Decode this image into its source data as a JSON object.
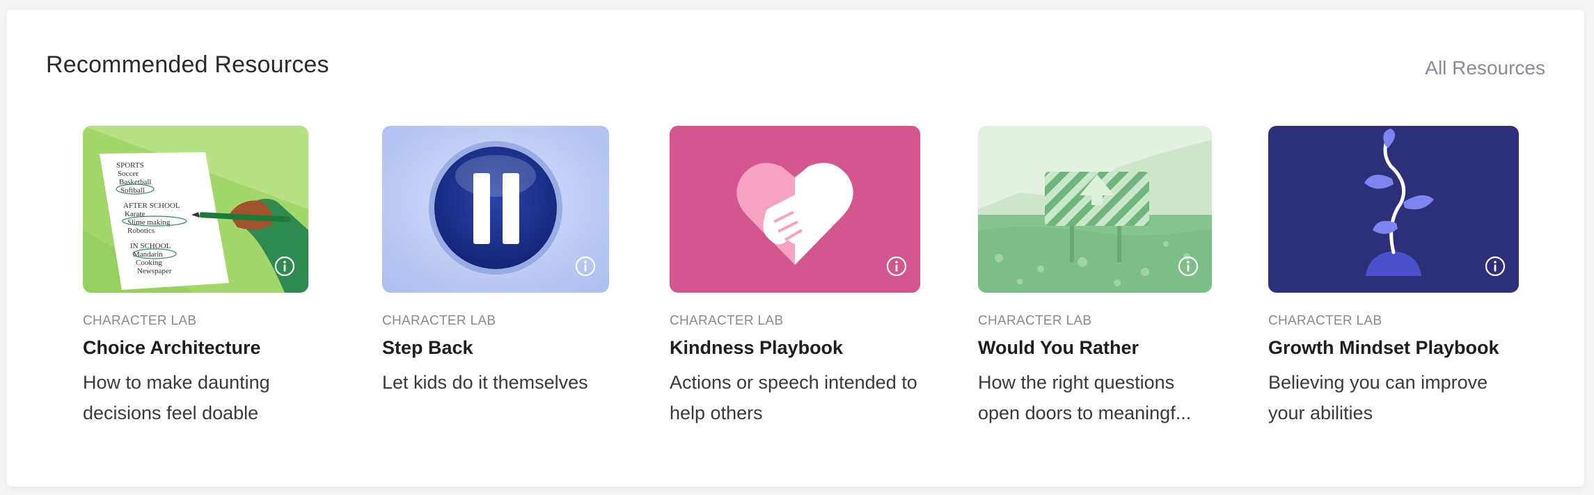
{
  "section": {
    "title": "Recommended Resources",
    "all_link": "All Resources"
  },
  "cards": [
    {
      "source": "CHARACTER LAB",
      "title": "Choice Architecture",
      "description": "How to make daunting decisions feel doable",
      "image_icon": "checklist-illustration",
      "image_text": [
        "SPORTS",
        "Soccer",
        "Basketball",
        "Softball",
        "AFTER SCHOOL",
        "Karate",
        "Slime making",
        "Robotics",
        "IN SCHOOL",
        "Mandarin",
        "Cooking",
        "Newspaper"
      ],
      "image_color": "#9fd66b"
    },
    {
      "source": "CHARACTER LAB",
      "title": "Step Back",
      "description": "Let kids do it themselves",
      "image_icon": "pause-button-illustration",
      "image_color": "#b8caf3"
    },
    {
      "source": "CHARACTER LAB",
      "title": "Kindness Playbook",
      "description": "Actions or speech intended to help others",
      "image_icon": "heart-handshake-illustration",
      "image_color": "#d4568e"
    },
    {
      "source": "CHARACTER LAB",
      "title": "Would You Rather",
      "description": "How the right questions open doors to meaningf...",
      "image_icon": "road-sign-illustration",
      "image_color": "#8fc79a"
    },
    {
      "source": "CHARACTER LAB",
      "title": "Growth Mindset Playbook",
      "description": "Believing you can improve your abilities",
      "image_icon": "sprouting-plant-illustration",
      "image_color": "#2e2f7a"
    }
  ]
}
